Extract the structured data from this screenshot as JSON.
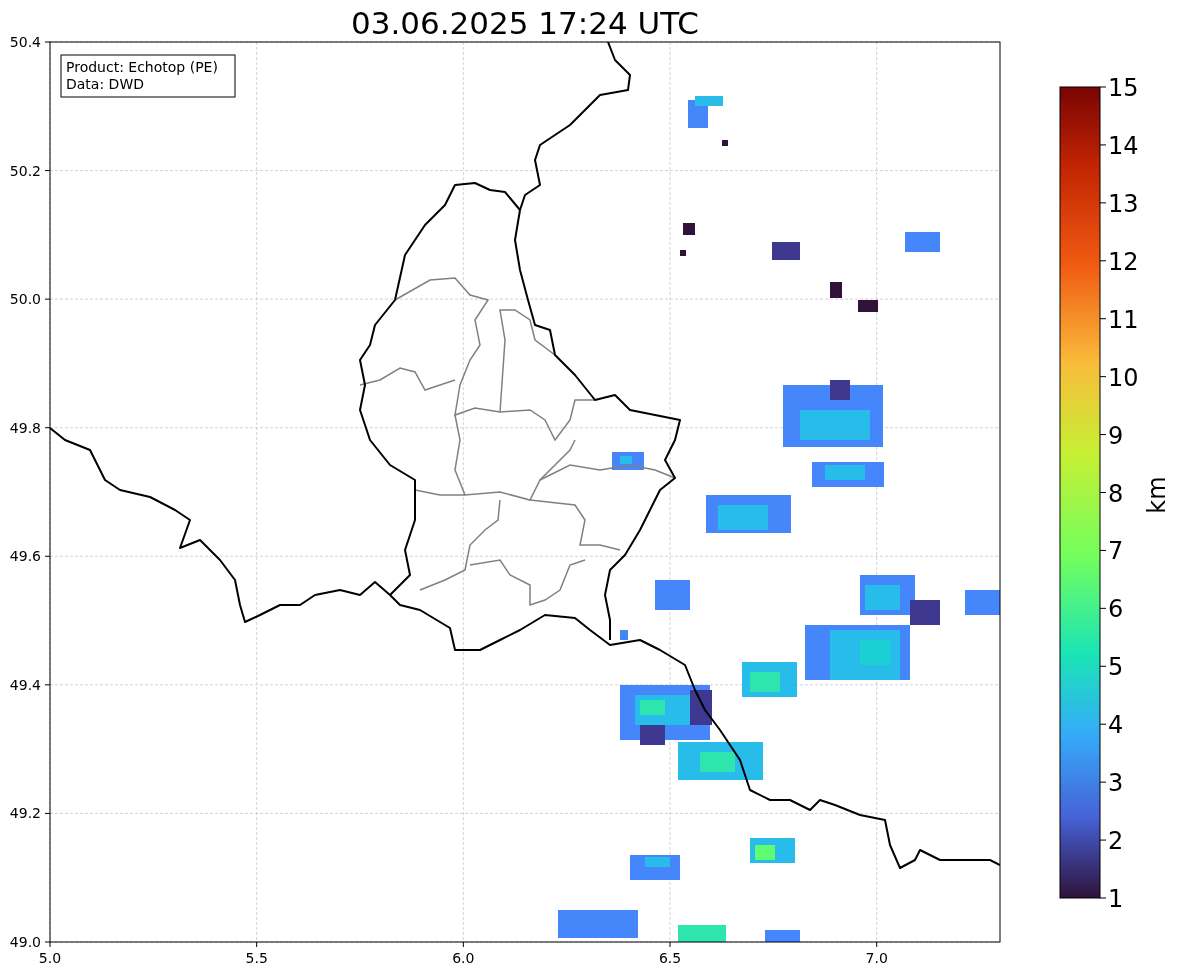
{
  "title": "03.06.2025 17:24 UTC",
  "info_box": [
    "Product: Echotop (PE)",
    "Data: DWD"
  ],
  "x_ticks": [
    "5.0",
    "5.5",
    "6.0",
    "6.5",
    "7.0"
  ],
  "y_ticks": [
    "50.4",
    "50.2",
    "50.0",
    "49.8",
    "49.6",
    "49.4",
    "49.2",
    "49.0"
  ],
  "colorbar": {
    "label": "km",
    "ticks": [
      "15",
      "14",
      "13",
      "12",
      "11",
      "10",
      "9",
      "8",
      "7",
      "6",
      "5",
      "4",
      "3",
      "2",
      "1"
    ]
  }
}
